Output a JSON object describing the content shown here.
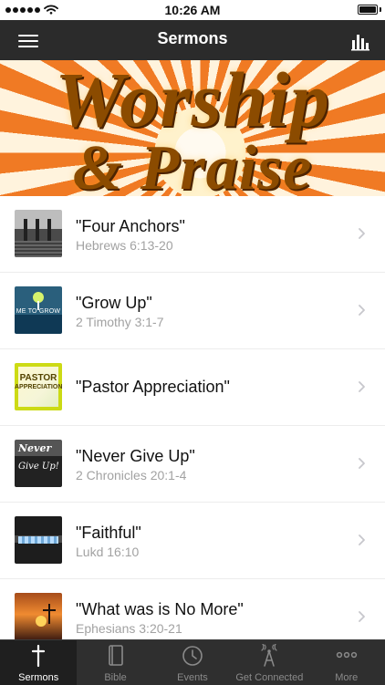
{
  "status_bar": {
    "time": "10:26 AM"
  },
  "nav": {
    "title": "Sermons"
  },
  "banner": {
    "line1": "Worship",
    "line2": "& Praise"
  },
  "sermons": [
    {
      "title": "\"Four Anchors\"",
      "reference": "Hebrews 6:13-20"
    },
    {
      "title": "\"Grow Up\"",
      "reference": "2 Timothy 3:1-7",
      "thumb_text": "ME TO GROW"
    },
    {
      "title": "\"Pastor Appreciation\"",
      "reference": "",
      "thumb_text_1": "PASTOR",
      "thumb_text_2": "APPRECIATION"
    },
    {
      "title": "\"Never Give Up\"",
      "reference": "2 Chronicles 20:1-4",
      "thumb_text_1": "Never",
      "thumb_text_2": "Give Up!"
    },
    {
      "title": "\"Faithful\"",
      "reference": "Lukd 16:10"
    },
    {
      "title": "\"What was is No More\"",
      "reference": "Ephesians 3:20-21"
    }
  ],
  "tabs": [
    {
      "label": "Sermons"
    },
    {
      "label": "Bible"
    },
    {
      "label": "Events"
    },
    {
      "label": "Get Connected"
    },
    {
      "label": "More"
    }
  ],
  "colors": {
    "nav_bg": "#2b2b2b",
    "tab_bg": "#2f2f2f",
    "active_tab_bg": "#1f1f1f",
    "subtext": "#a2a2a2"
  },
  "icons": {
    "menu": "hamburger-menu-icon",
    "stats": "bar-chart-icon",
    "chevron": "chevron-right-icon",
    "sermons_tab": "cross-icon",
    "bible_tab": "book-icon",
    "events_tab": "clock-icon",
    "connected_tab": "broadcast-tower-icon",
    "more_tab": "more-dots-icon"
  }
}
